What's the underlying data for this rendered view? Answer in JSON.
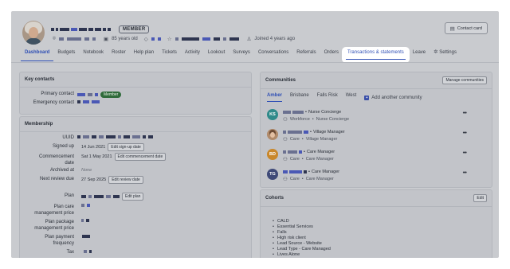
{
  "profile": {
    "member_badge": "MEMBER",
    "age": "85 years old",
    "joined": "Joined 4 years ago",
    "contact_card_label": "Contact card"
  },
  "tabs": [
    "Dashboard",
    "Budgets",
    "Notebook",
    "Roster",
    "Help plan",
    "Tickets",
    "Activity",
    "Lookout",
    "Surveys",
    "Conversations",
    "Referrals",
    "Orders",
    "Transactions & statements",
    "Leave",
    "Settings"
  ],
  "key_contacts": {
    "title": "Key contacts",
    "primary_label": "Primary contact",
    "primary_badge": "Member",
    "emergency_label": "Emergency contact"
  },
  "membership": {
    "title": "Membership",
    "uuid_label": "UUID",
    "signed_up_label": "Signed up",
    "signed_up_value": "14 Jun 2021",
    "edit_signup": "Edit sign-up date",
    "commencement_label": "Commencement date",
    "commencement_value": "Sat 1 May 2021",
    "edit_commencement": "Edit commencement date",
    "archived_label": "Archived at",
    "archived_value": "None",
    "review_label": "Next review due",
    "review_value": "27 Sep 2025",
    "edit_review": "Edit review date",
    "plan_label": "Plan",
    "edit_plan": "Edit plan",
    "care_price_label": "Plan care management price",
    "package_price_label": "Plan package management price",
    "payment_freq_label": "Plan payment frequency",
    "tax_label": "Tax"
  },
  "communities": {
    "title": "Communities",
    "manage_label": "Manage communities",
    "tabs": [
      "Amber",
      "Brisbane",
      "Falls Risk",
      "West"
    ],
    "add_label": "Add another community",
    "items": [
      {
        "initials": "KS",
        "role": "Nurse Concierge",
        "team": "Workforce",
        "sub_role": "Nurse Concierge",
        "color": "#2f8a8a"
      },
      {
        "initials": "",
        "role": "Village Manager",
        "team": "Care",
        "sub_role": "Village Manager",
        "color": "#b08a6a"
      },
      {
        "initials": "BD",
        "role": "Care Manager",
        "team": "Care",
        "sub_role": "Care Manager",
        "color": "#c9872a"
      },
      {
        "initials": "TG",
        "role": "Care Manager",
        "team": "Care",
        "sub_role": "Care Manager",
        "color": "#3f4a78"
      }
    ]
  },
  "cohorts": {
    "title": "Cohorts",
    "edit_label": "Edit",
    "items": [
      "CALD",
      "Essential Services",
      "Falls",
      "High risk client",
      "Lead Source - Website",
      "Lead Type - Care Managed",
      "Lives Alone"
    ]
  }
}
